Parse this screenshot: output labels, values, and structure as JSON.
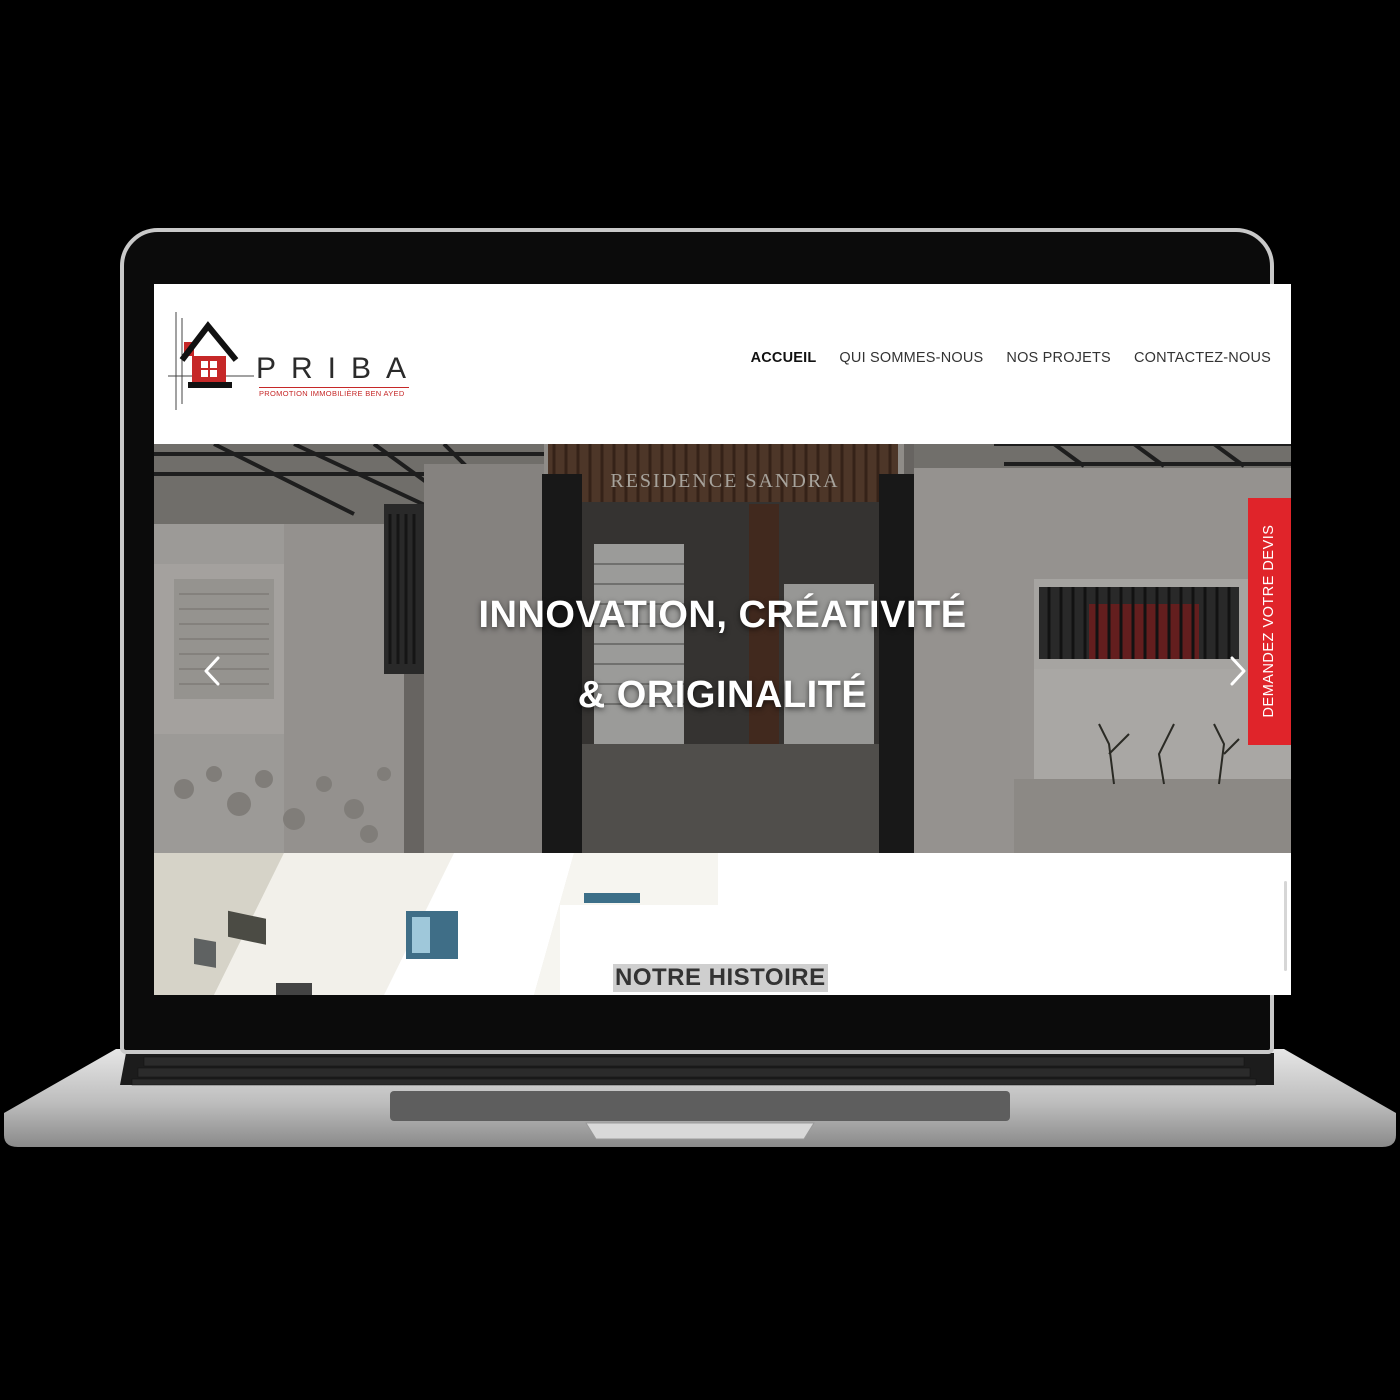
{
  "logo": {
    "name": "PRIBA",
    "tagline": "PROMOTION IMMOBILIÈRE BEN AYED"
  },
  "nav": {
    "items": [
      {
        "label": "ACCUEIL",
        "active": true
      },
      {
        "label": "QUI SOMMES-NOUS",
        "active": false
      },
      {
        "label": "NOS PROJETS",
        "active": false
      },
      {
        "label": "CONTACTEZ-NOUS",
        "active": false
      }
    ]
  },
  "hero": {
    "sign": "RESIDENCE SANDRA",
    "headline_line1": "INNOVATION, CRÉATIVITÉ",
    "headline_line2": "& ORIGINALITÉ"
  },
  "cta": {
    "devis_label": "DEMANDEZ VOTRE DEVIS"
  },
  "story": {
    "title": "NOTRE HISTOIRE"
  },
  "colors": {
    "accent_red": "#e0242a",
    "logo_red": "#c62828",
    "text_dark": "#333333"
  }
}
